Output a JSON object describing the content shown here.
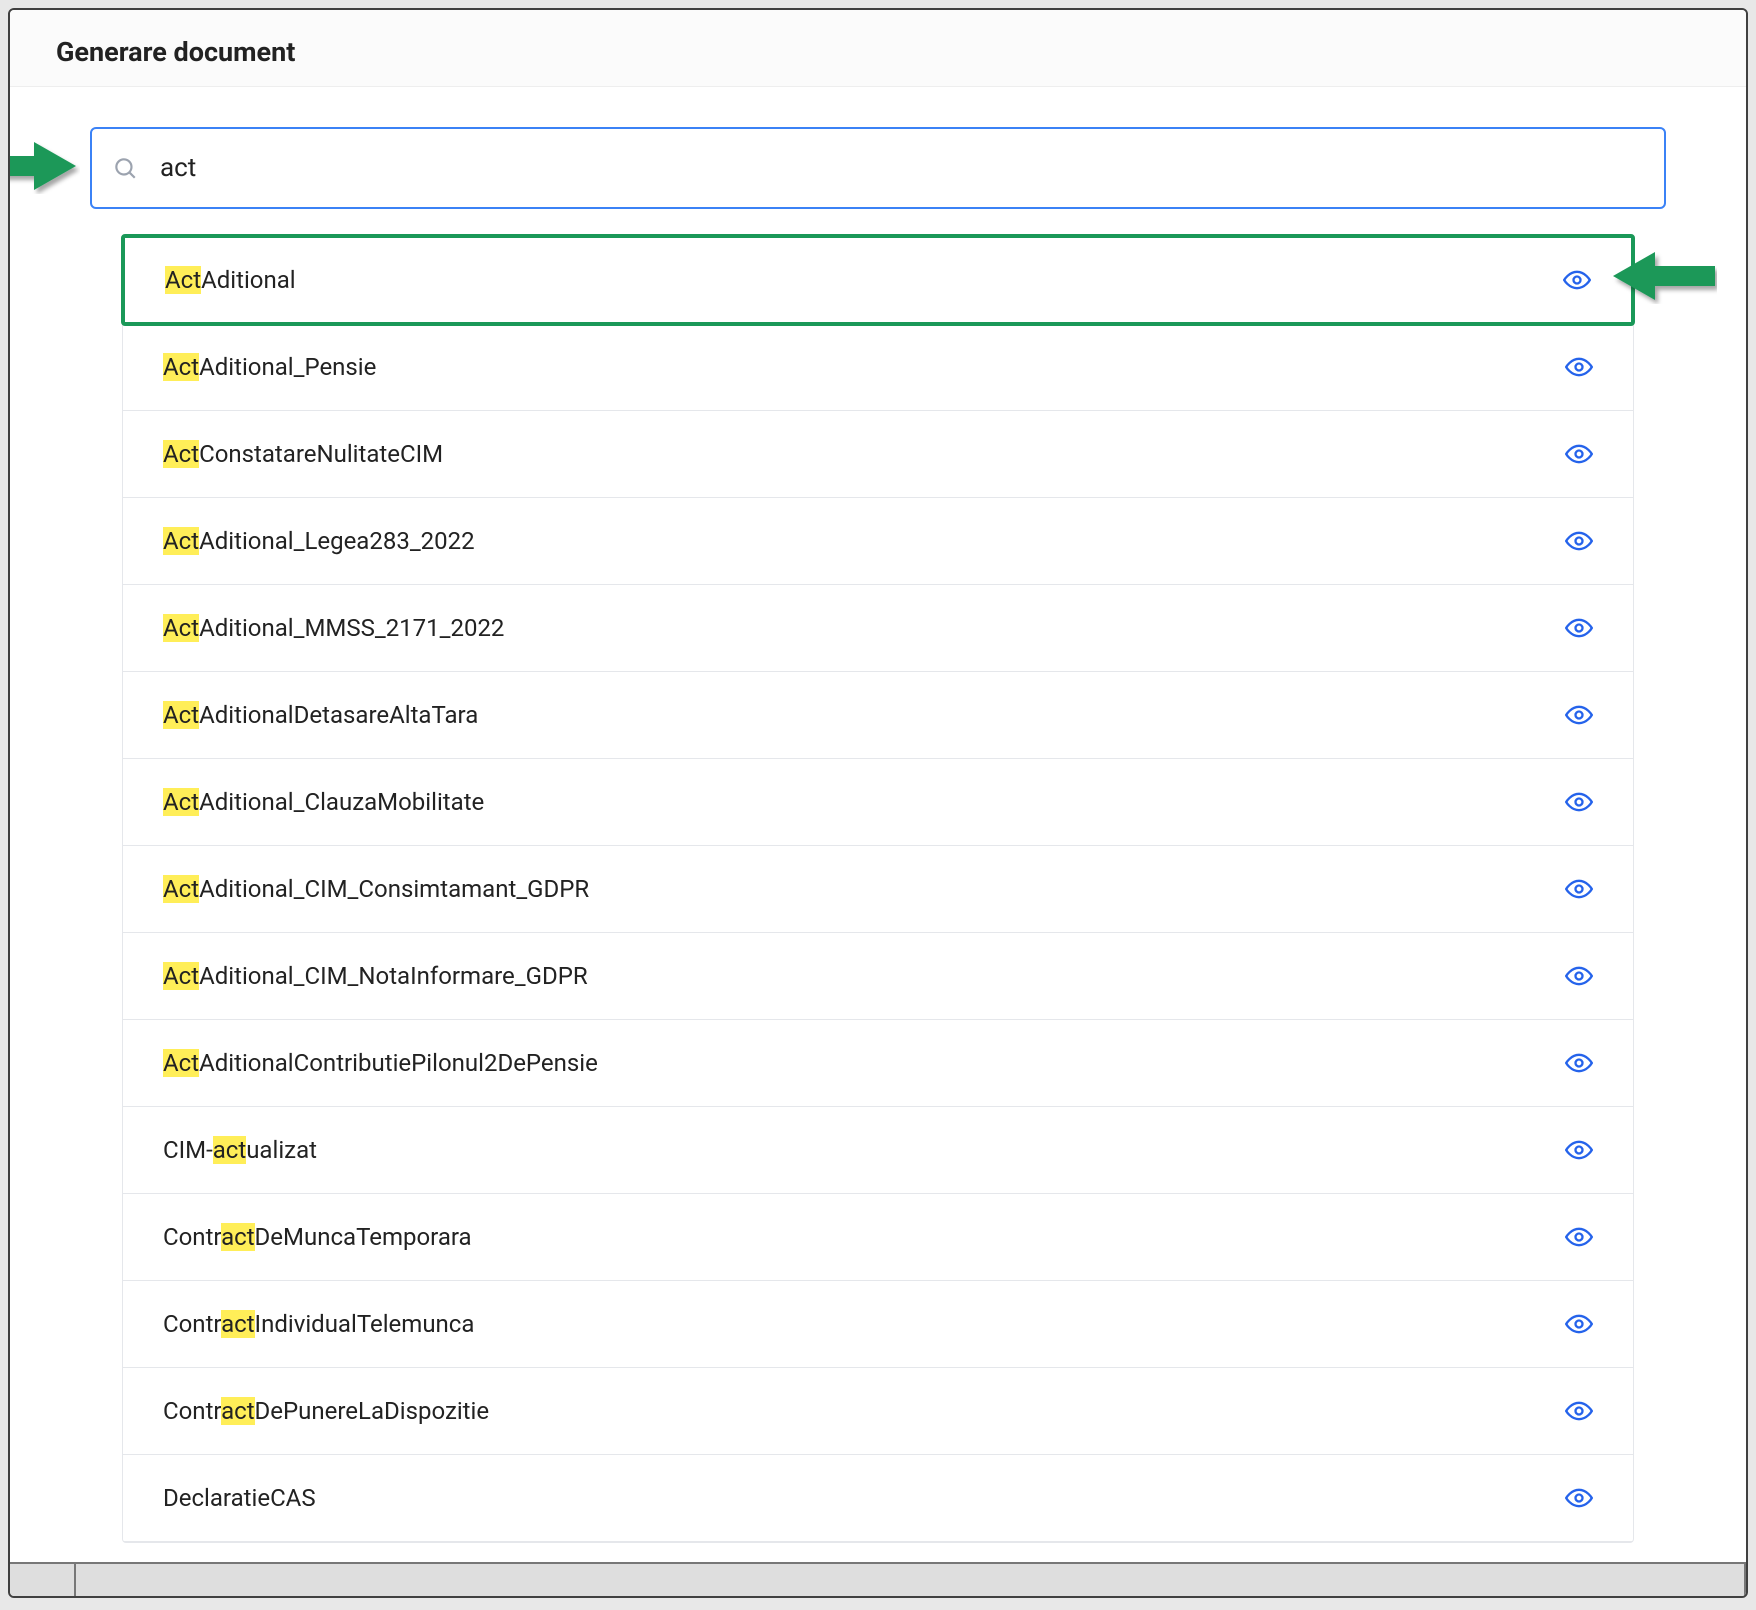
{
  "header": {
    "title": "Generare document"
  },
  "search": {
    "value": "act",
    "query": "act"
  },
  "results": [
    {
      "label": "ActAditional",
      "selected": true
    },
    {
      "label": "ActAditional_Pensie"
    },
    {
      "label": "ActConstatareNulitateCIM"
    },
    {
      "label": "ActAditional_Legea283_2022"
    },
    {
      "label": "ActAditional_MMSS_2171_2022"
    },
    {
      "label": "ActAditionalDetasareAltaTara"
    },
    {
      "label": "ActAditional_ClauzaMobilitate"
    },
    {
      "label": "ActAditional_CIM_Consimtamant_GDPR"
    },
    {
      "label": "ActAditional_CIM_NotaInformare_GDPR"
    },
    {
      "label": "ActAditionalContributiePilonul2DePensie"
    },
    {
      "label": "CIM-actualizat"
    },
    {
      "label": "ContractDeMuncaTemporara"
    },
    {
      "label": "ContractIndividualTelemunca"
    },
    {
      "label": "ContractDePunereLaDispozitie"
    },
    {
      "label": "DeclaratieCAS"
    }
  ],
  "colors": {
    "highlight": "#ffee58",
    "selected_border": "#1a9858",
    "focus_border": "#3b82f6",
    "eye": "#2563eb",
    "arrow": "#1a9858"
  }
}
